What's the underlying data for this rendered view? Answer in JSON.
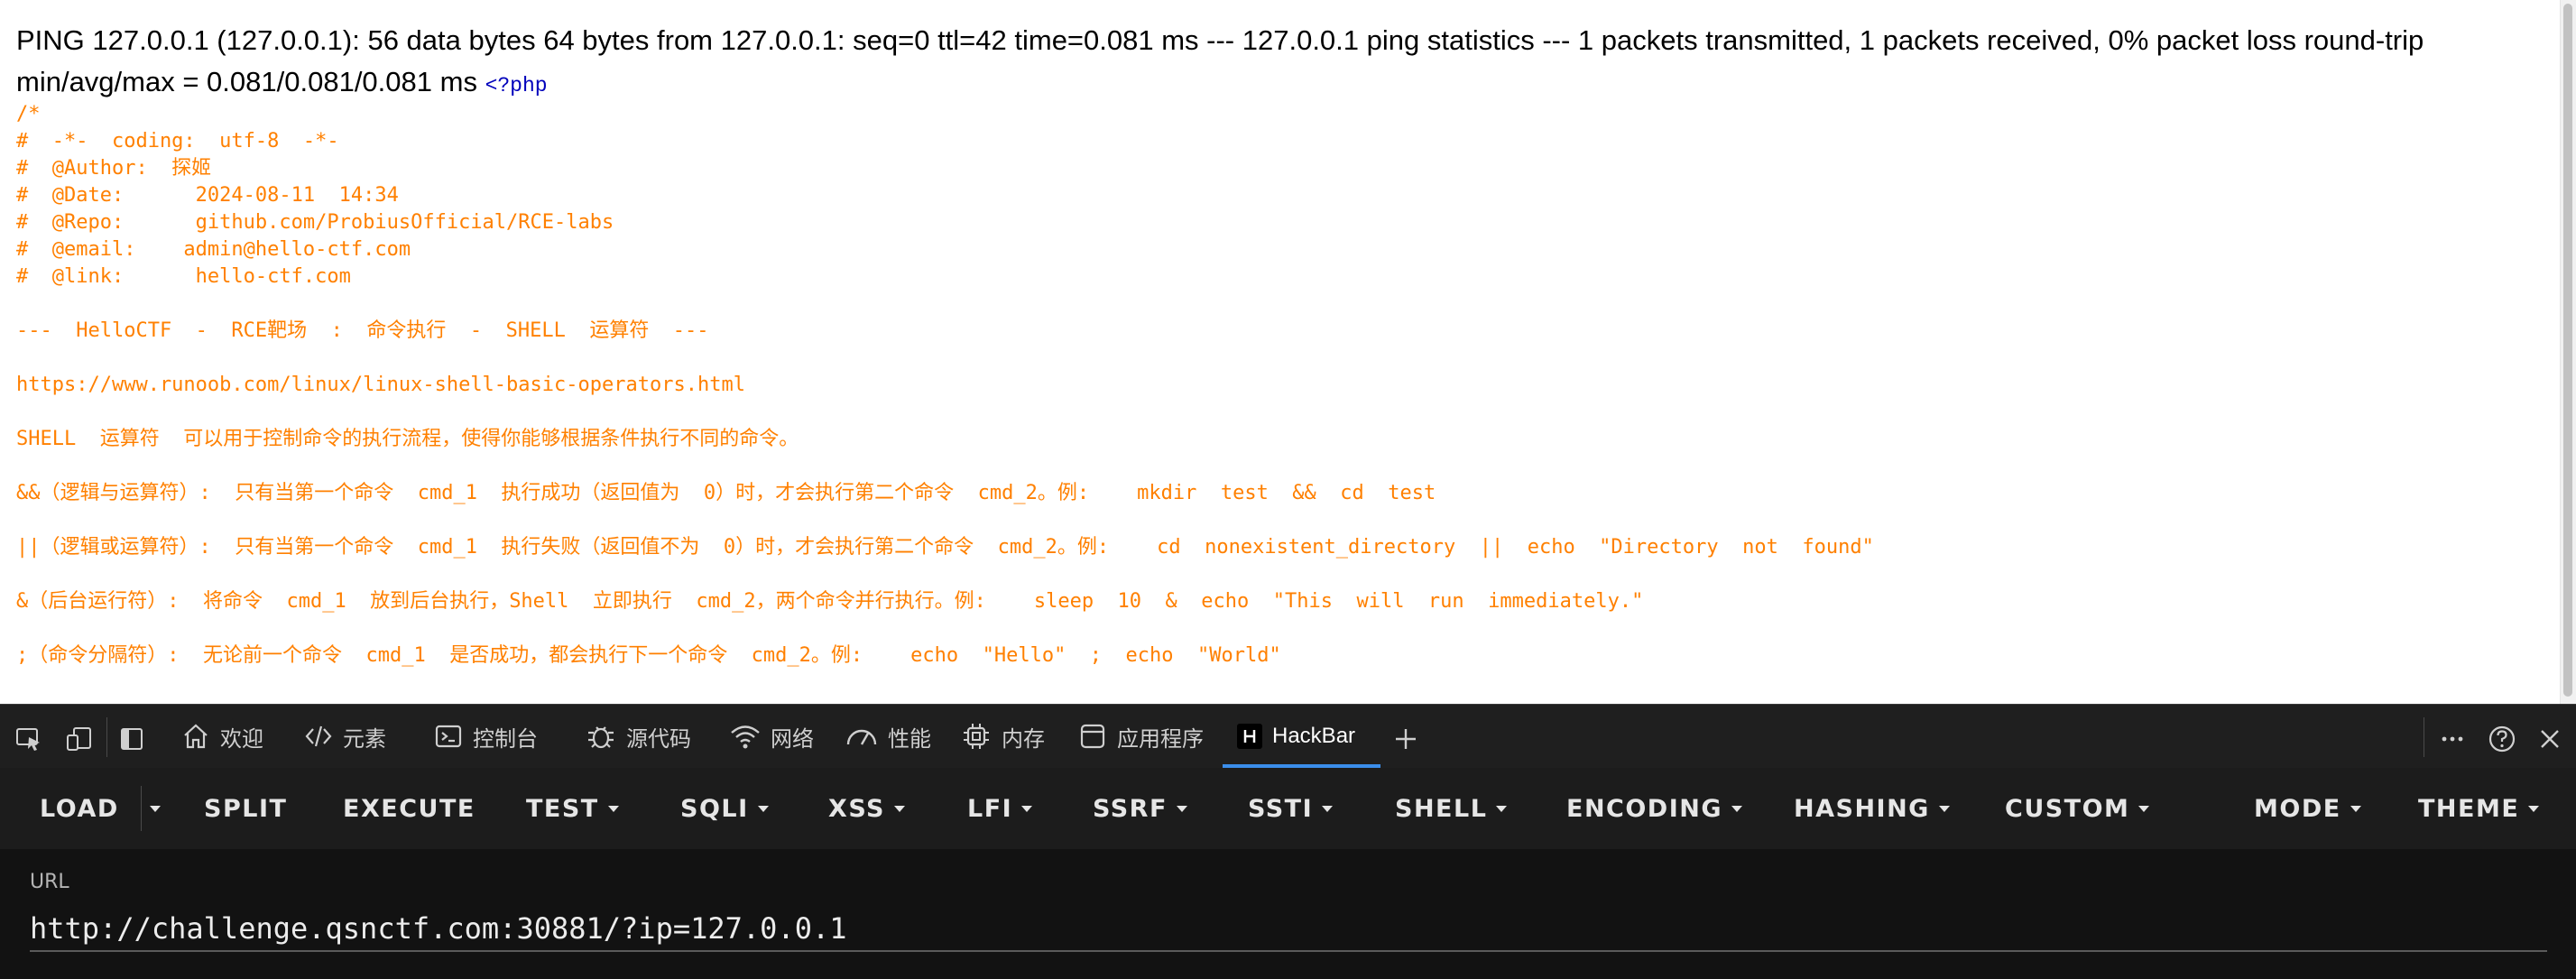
{
  "page": {
    "ping_output": "PING 127.0.0.1 (127.0.0.1): 56 data bytes 64 bytes from 127.0.0.1: seq=0 ttl=42 time=0.081 ms --- 127.0.0.1 ping statistics --- 1 packets transmitted, 1 packets received, 0% packet loss round-trip min/avg/max = 0.081/0.081/0.081 ms",
    "php_open_tag": "<?php",
    "code_lines": [
      "/*",
      "#  -*-  coding:  utf-8  -*-",
      "#  @Author:  探姬",
      "#  @Date:      2024-08-11  14:34",
      "#  @Repo:      github.com/ProbiusOfficial/RCE-labs",
      "#  @email:    admin@hello-ctf.com",
      "#  @link:      hello-ctf.com",
      "---  HelloCTF  -  RCE靶场  :  命令执行  -  SHELL  运算符  ---",
      "https://www.runoob.com/linux/linux-shell-basic-operators.html",
      "SHELL  运算符  可以用于控制命令的执行流程，使得你能够根据条件执行不同的命令。",
      "&&（逻辑与运算符）:  只有当第一个命令  cmd_1  执行成功（返回值为  0）时，才会执行第二个命令  cmd_2。例:    mkdir  test  &&  cd  test",
      "||（逻辑或运算符）:  只有当第一个命令  cmd_1  执行失败（返回值不为  0）时，才会执行第二个命令  cmd_2。例:    cd  nonexistent_directory  ||  echo  \"Directory  not  found\"",
      "&（后台运行符）:  将命令  cmd_1  放到后台执行，Shell  立即执行  cmd_2，两个命令并行执行。例:    sleep  10  &  echo  \"This  will  run  immediately.\"",
      ";（命令分隔符）:  无论前一个命令  cmd_1  是否成功，都会执行下一个命令  cmd_2。例:    echo  \"Hello\"  ;  echo  \"World\""
    ],
    "code_color": "#ff8000",
    "php_tag_color": "#0000bb"
  },
  "devtools": {
    "tabs": [
      {
        "label": "欢迎",
        "icon": "home-icon"
      },
      {
        "label": "元素",
        "icon": "code-icon"
      },
      {
        "label": "控制台",
        "icon": "console-icon"
      },
      {
        "label": "源代码",
        "icon": "bug-icon"
      },
      {
        "label": "网络",
        "icon": "wifi-icon"
      },
      {
        "label": "性能",
        "icon": "gauge-icon"
      },
      {
        "label": "内存",
        "icon": "chip-icon"
      },
      {
        "label": "应用程序",
        "icon": "window-icon"
      },
      {
        "label": "HackBar",
        "icon": "hackbar-icon"
      }
    ],
    "active_tab": "HackBar",
    "accent": "#3b8eea"
  },
  "hackbar": {
    "buttons": [
      {
        "label": "LOAD",
        "dropdown": false
      },
      {
        "label": "SPLIT",
        "dropdown": false
      },
      {
        "label": "EXECUTE",
        "dropdown": false
      },
      {
        "label": "TEST",
        "dropdown": true
      },
      {
        "label": "SQLI",
        "dropdown": true
      },
      {
        "label": "XSS",
        "dropdown": true
      },
      {
        "label": "LFI",
        "dropdown": true
      },
      {
        "label": "SSRF",
        "dropdown": true
      },
      {
        "label": "SSTI",
        "dropdown": true
      },
      {
        "label": "SHELL",
        "dropdown": true
      },
      {
        "label": "ENCODING",
        "dropdown": true
      },
      {
        "label": "HASHING",
        "dropdown": true
      },
      {
        "label": "CUSTOM",
        "dropdown": true
      },
      {
        "label": "MODE",
        "dropdown": true
      },
      {
        "label": "THEME",
        "dropdown": true
      }
    ],
    "url_label": "URL",
    "url_value": "http://challenge.qsnctf.com:30881/?ip=127.0.0.1"
  }
}
